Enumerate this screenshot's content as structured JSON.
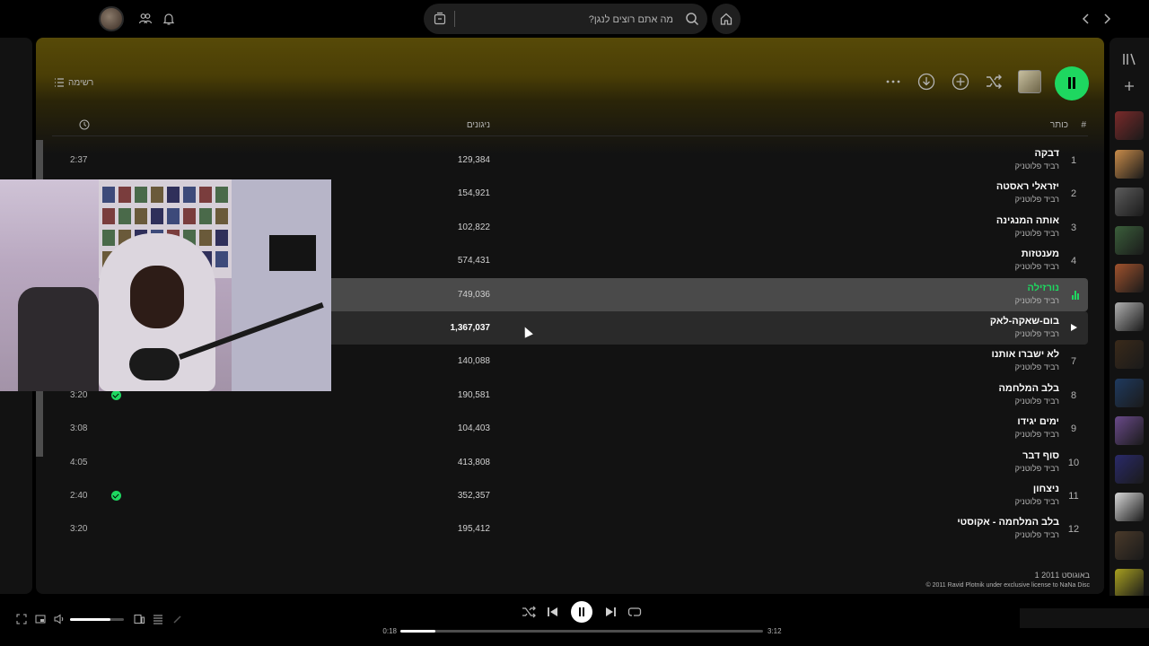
{
  "header": {
    "search_placeholder": "מה אתם רוצים לנגן?"
  },
  "actions": {
    "list_view_label": "רשימה"
  },
  "table_header": {
    "index": "#",
    "title": "כותר",
    "plays": "ניגונים"
  },
  "tracks": [
    {
      "num": "1",
      "title": "דבקה",
      "artist": "רביד פלוטניק",
      "plays": "129,384",
      "duration": "2:37",
      "saved": false,
      "state": ""
    },
    {
      "num": "2",
      "title": "יזראלי ראסטה",
      "artist": "רביד פלוטניק",
      "plays": "154,921",
      "duration": "",
      "saved": false,
      "state": ""
    },
    {
      "num": "3",
      "title": "אותה המנגינה",
      "artist": "רביד פלוטניק",
      "plays": "102,822",
      "duration": "",
      "saved": false,
      "state": ""
    },
    {
      "num": "4",
      "title": "מענטזות",
      "artist": "רביד פלוטניק",
      "plays": "574,431",
      "duration": "",
      "saved": false,
      "state": ""
    },
    {
      "num": "",
      "title": "נורזילה",
      "artist": "רביד פלוטניק",
      "plays": "749,036",
      "duration": "",
      "saved": false,
      "state": "playing"
    },
    {
      "num": "",
      "title": "בום-שאקה-לאק",
      "artist": "רביד פלוטניק",
      "plays": "1,367,037",
      "duration": "",
      "saved": false,
      "state": "hover"
    },
    {
      "num": "7",
      "title": "לא ישברו אותנו",
      "artist": "רביד פלוטניק",
      "plays": "140,088",
      "duration": "",
      "saved": false,
      "state": ""
    },
    {
      "num": "8",
      "title": "בלב המלחמה",
      "artist": "רביד פלוטניק",
      "plays": "190,581",
      "duration": "3:20",
      "saved": true,
      "state": ""
    },
    {
      "num": "9",
      "title": "ימים יגידו",
      "artist": "רביד פלוטניק",
      "plays": "104,403",
      "duration": "3:08",
      "saved": false,
      "state": ""
    },
    {
      "num": "10",
      "title": "סוף דבר",
      "artist": "רביד פלוטניק",
      "plays": "413,808",
      "duration": "4:05",
      "saved": false,
      "state": ""
    },
    {
      "num": "11",
      "title": "ניצחון",
      "artist": "רביד פלוטניק",
      "plays": "352,357",
      "duration": "2:40",
      "saved": true,
      "state": ""
    },
    {
      "num": "12",
      "title": "בלב המלחמה - אקוסטי",
      "artist": "רביד פלוטניק",
      "plays": "195,412",
      "duration": "3:20",
      "saved": false,
      "state": ""
    }
  ],
  "footer": {
    "release_date": "1 באוגוסט 2011",
    "copyright": "© 2011 Ravid Plotnik under exclusive license to NaNa Disc"
  },
  "player": {
    "current_time": "0:18",
    "total_time": "3:12",
    "progress": 0.097,
    "volume": 0.75
  },
  "colors": {
    "accent": "#1ed760",
    "header_gradient": "#574a08",
    "background": "#121212"
  },
  "library_thumbs": [
    "#7a2a2a",
    "#c98c4a",
    "#5c5c5c",
    "#3b5f3b",
    "#a0522d",
    "#b0b0b0",
    "#3a2a1a",
    "#1f3a5f",
    "#6a4a8a",
    "#2a2a6a",
    "#d8d8d8",
    "#4a3a2a",
    "#a8a020",
    "#606060"
  ]
}
